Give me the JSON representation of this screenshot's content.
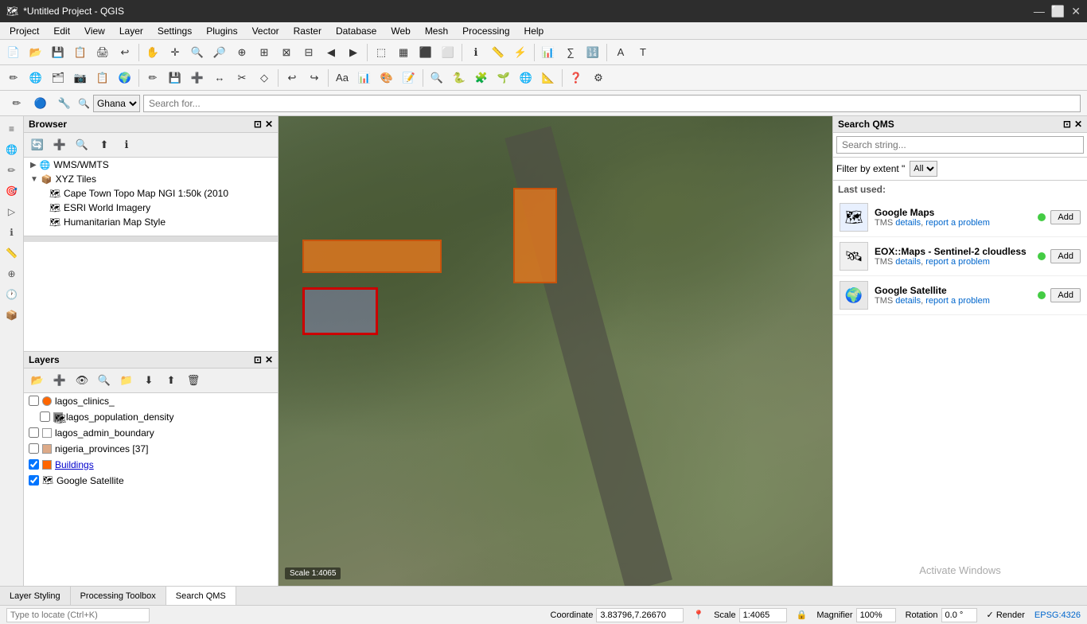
{
  "app": {
    "title": "*Untitled Project - QGIS",
    "icon": "🗺"
  },
  "titlebar": {
    "controls": {
      "minimize": "—",
      "maximize": "⬜",
      "close": "✕"
    }
  },
  "menubar": {
    "items": [
      "Project",
      "Edit",
      "View",
      "Layer",
      "Settings",
      "Plugins",
      "Vector",
      "Raster",
      "Database",
      "Web",
      "Mesh",
      "Processing",
      "Help"
    ]
  },
  "locatorbar": {
    "placeholder": "Search for...",
    "country": "Ghana"
  },
  "browser": {
    "title": "Browser",
    "items": [
      {
        "label": "WMS/WMTS",
        "level": 1,
        "arrow": "▶",
        "icon": "🌐"
      },
      {
        "label": "XYZ Tiles",
        "level": 1,
        "arrow": "▼",
        "icon": "📦"
      },
      {
        "label": "Cape Town Topo Map NGI 1:50k (2010",
        "level": 2,
        "arrow": "",
        "icon": "🗺"
      },
      {
        "label": "ESRI World Imagery",
        "level": 2,
        "arrow": "",
        "icon": "🗺"
      },
      {
        "label": "Humanitarian Map Style",
        "level": 2,
        "arrow": "",
        "icon": "🗺"
      }
    ]
  },
  "layers": {
    "title": "Layers",
    "items": [
      {
        "name": "lagos_clinics_",
        "visible": false,
        "color": "#ff6600",
        "dot": true,
        "indent": 0,
        "underline": false
      },
      {
        "name": "lagos_population_density",
        "visible": false,
        "color": "#888888",
        "dot": false,
        "indent": 1,
        "underline": false
      },
      {
        "name": "lagos_admin_boundary",
        "visible": false,
        "color": "#ffffff",
        "dot": false,
        "indent": 0,
        "underline": false
      },
      {
        "name": "nigeria_provinces [37]",
        "visible": false,
        "color": "#ddaa88",
        "dot": false,
        "indent": 0,
        "underline": false
      },
      {
        "name": "Buildings",
        "visible": true,
        "color": "#ff6600",
        "dot": false,
        "indent": 0,
        "underline": true
      },
      {
        "name": "Google Satellite",
        "visible": true,
        "color": "#888888",
        "dot": false,
        "indent": 0,
        "underline": false
      }
    ]
  },
  "qms": {
    "title": "Search QMS",
    "search_placeholder": "Search string...",
    "filter_label": "Filter by extent \"",
    "filter_options": [
      "All"
    ],
    "last_used_label": "Last used:",
    "items": [
      {
        "name": "Google Maps",
        "type": "TMS",
        "details_link": "details",
        "report_link": "report a problem",
        "status": "online",
        "add_label": "Add",
        "icon": "🗺"
      },
      {
        "name": "EOX::Maps - Sentinel-2 cloudless",
        "type": "TMS",
        "details_link": "details",
        "report_link": "report a problem",
        "status": "online",
        "add_label": "Add",
        "icon": "🛰"
      },
      {
        "name": "Google Satellite",
        "type": "TMS",
        "details_link": "details",
        "report_link": "report a problem",
        "status": "online",
        "add_label": "Add",
        "icon": "🌍"
      }
    ],
    "activate_text": "Activate Windows"
  },
  "bottom_tabs": [
    {
      "label": "Layer Styling",
      "active": false
    },
    {
      "label": "Processing Toolbox",
      "active": false
    },
    {
      "label": "Search QMS",
      "active": true
    }
  ],
  "statusbar": {
    "coordinate_label": "Coordinate",
    "coordinate_value": "3.83796,7.26670",
    "scale_label": "Scale",
    "scale_value": "1:4065",
    "magnifier_label": "Magnifier",
    "magnifier_value": "100%",
    "rotation_label": "Rotation",
    "rotation_value": "0.0 °",
    "render_label": "✓ Render",
    "epsg_label": "EPSG:4326",
    "locate_placeholder": "Type to locate (Ctrl+K)"
  }
}
